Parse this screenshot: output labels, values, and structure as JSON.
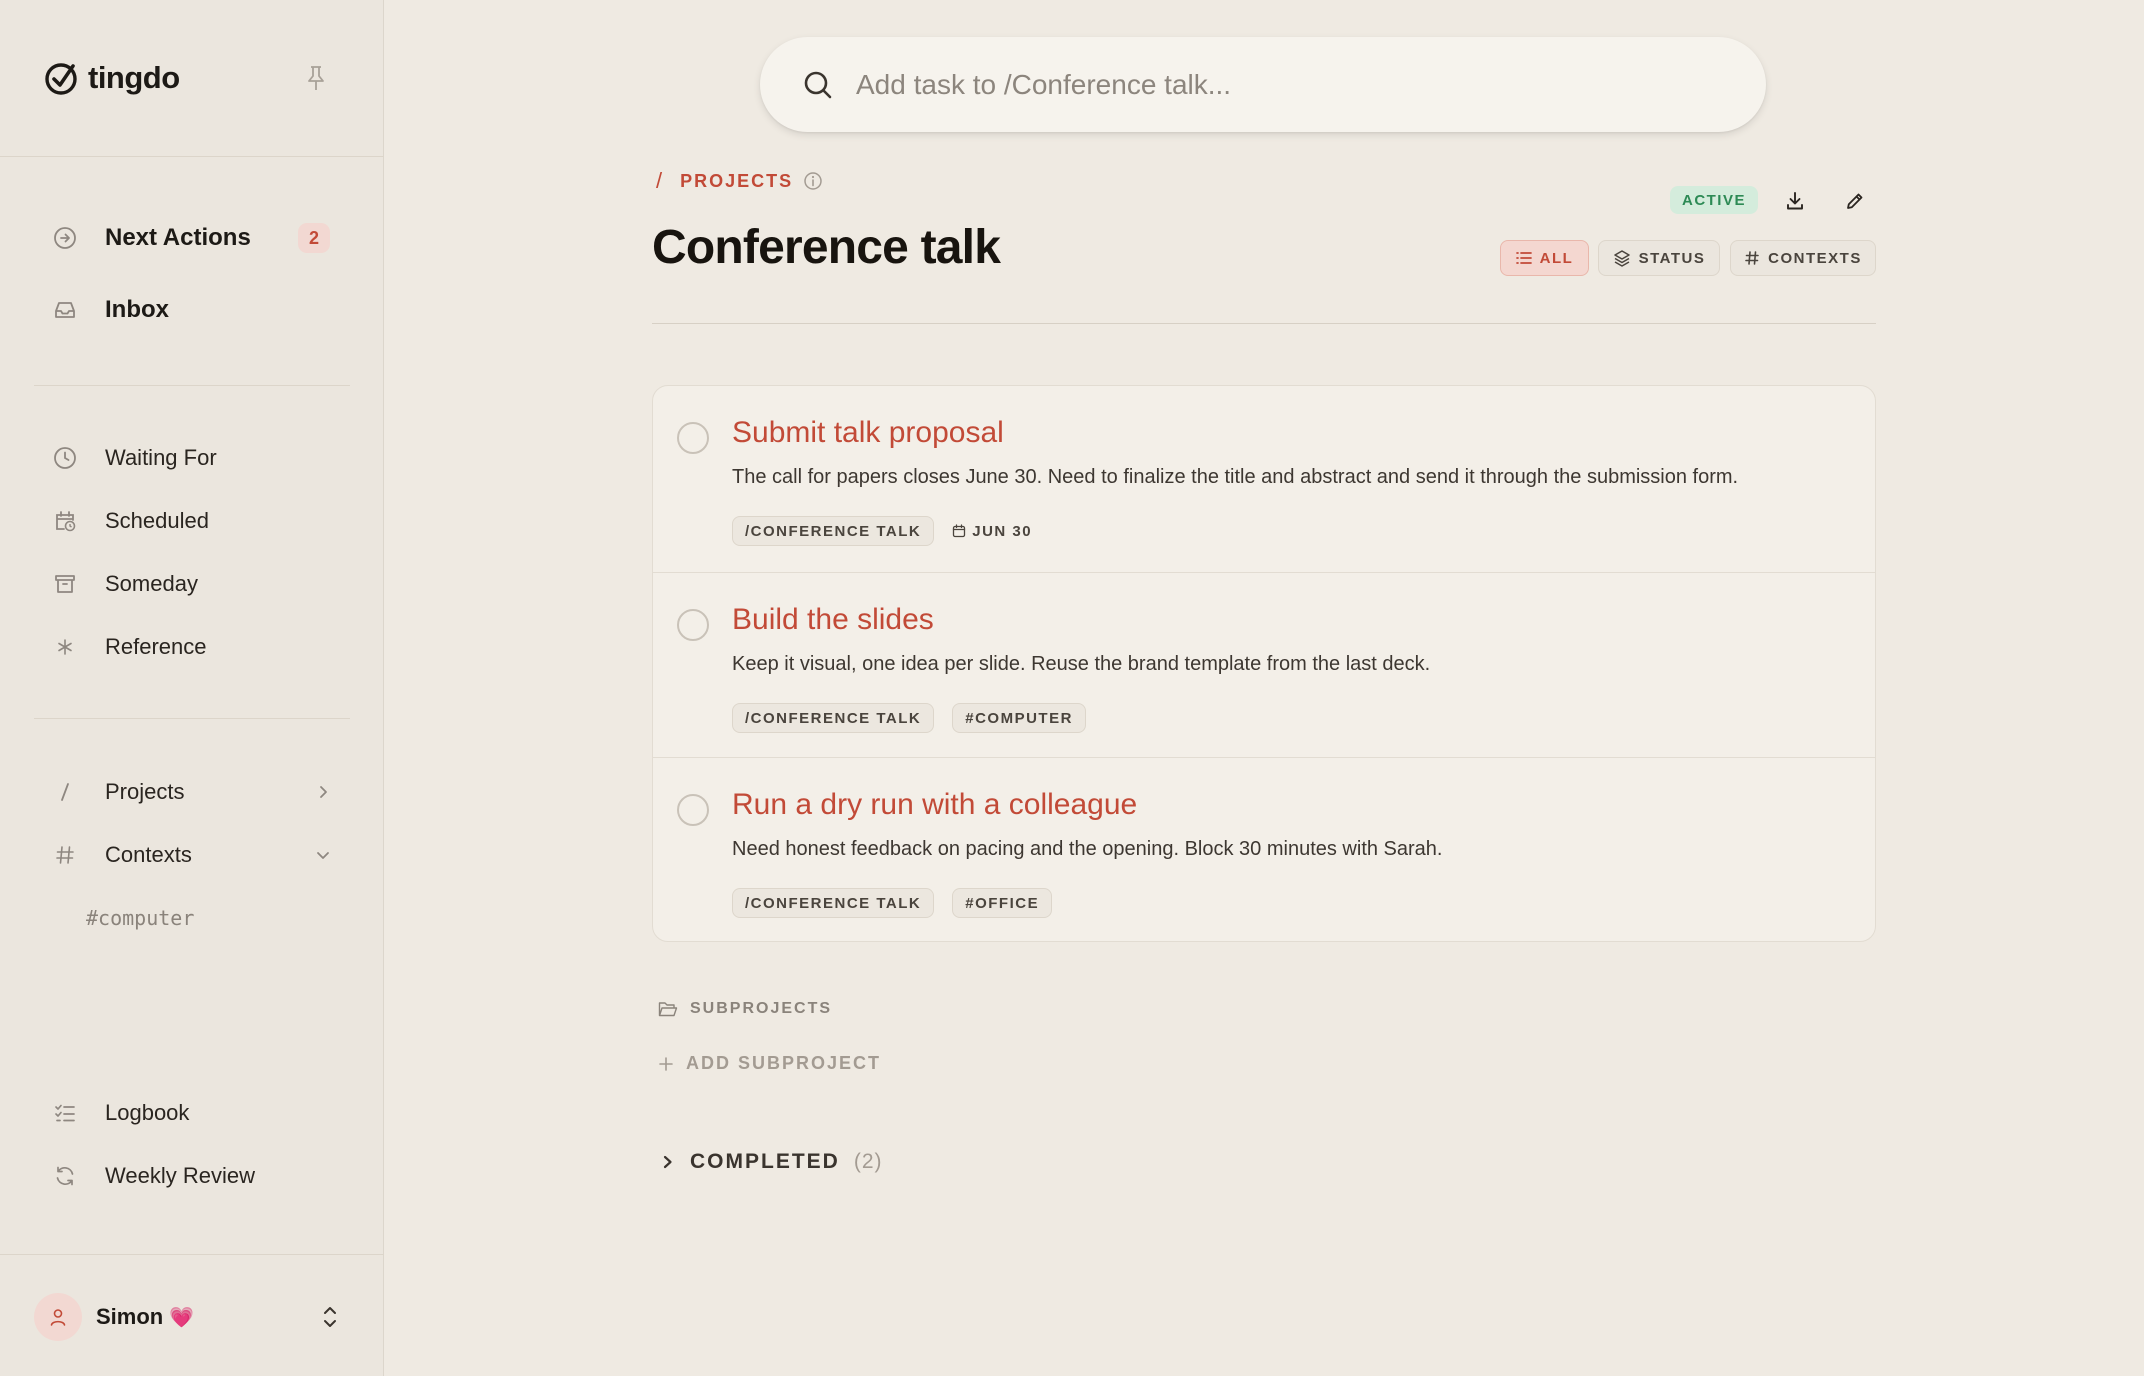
{
  "app": {
    "name": "tingdo"
  },
  "sidebar": {
    "primary": [
      {
        "label": "Next Actions",
        "icon": "arrow-circle-icon",
        "badge": "2"
      },
      {
        "label": "Inbox",
        "icon": "inbox-icon"
      }
    ],
    "lists": [
      {
        "label": "Waiting For",
        "icon": "clock-icon"
      },
      {
        "label": "Scheduled",
        "icon": "calendar-clock-icon"
      },
      {
        "label": "Someday",
        "icon": "archive-icon"
      },
      {
        "label": "Reference",
        "icon": "asterisk-icon"
      }
    ],
    "groups": [
      {
        "label": "Projects",
        "icon": "slash-icon",
        "chevron": "chevron-right-icon"
      },
      {
        "label": "Contexts",
        "icon": "hash-icon",
        "chevron": "chevron-down-icon"
      }
    ],
    "context_items": [
      "#computer"
    ],
    "footer": [
      {
        "label": "Logbook",
        "icon": "checklist-icon"
      },
      {
        "label": "Weekly Review",
        "icon": "refresh-icon"
      }
    ],
    "user": {
      "name": "Simon",
      "emoji": "💗"
    }
  },
  "search": {
    "placeholder": "Add task to /Conference talk..."
  },
  "breadcrumb": {
    "slash": "/",
    "label": "PROJECTS"
  },
  "project": {
    "title": "Conference talk",
    "status": "ACTIVE"
  },
  "views": [
    {
      "label": "ALL",
      "icon": "list-icon",
      "active": true
    },
    {
      "label": "STATUS",
      "icon": "layers-icon",
      "active": false
    },
    {
      "label": "CONTEXTS",
      "icon": "hash-icon",
      "active": false
    }
  ],
  "tasks": [
    {
      "title": "Submit talk proposal",
      "description": "The call for papers closes June 30. Need to finalize the title and abstract and send it through the submission form.",
      "tags": [
        "/CONFERENCE TALK"
      ],
      "due": "JUN 30"
    },
    {
      "title": "Build the slides",
      "description": "Keep it visual, one idea per slide. Reuse the brand template from the last deck.",
      "tags": [
        "/CONFERENCE TALK",
        "#COMPUTER"
      ]
    },
    {
      "title": "Run a dry run with a colleague",
      "description": "Need honest feedback on pacing and the opening. Block 30 minutes with Sarah.",
      "tags": [
        "/CONFERENCE TALK",
        "#OFFICE"
      ]
    }
  ],
  "subprojects": {
    "label": "SUBPROJECTS",
    "add_label": "ADD SUBPROJECT"
  },
  "completed": {
    "label": "COMPLETED",
    "count": "(2)"
  },
  "colors": {
    "accent": "#c24a37",
    "active_green": "#2d8a55",
    "background": "#efeae2"
  }
}
